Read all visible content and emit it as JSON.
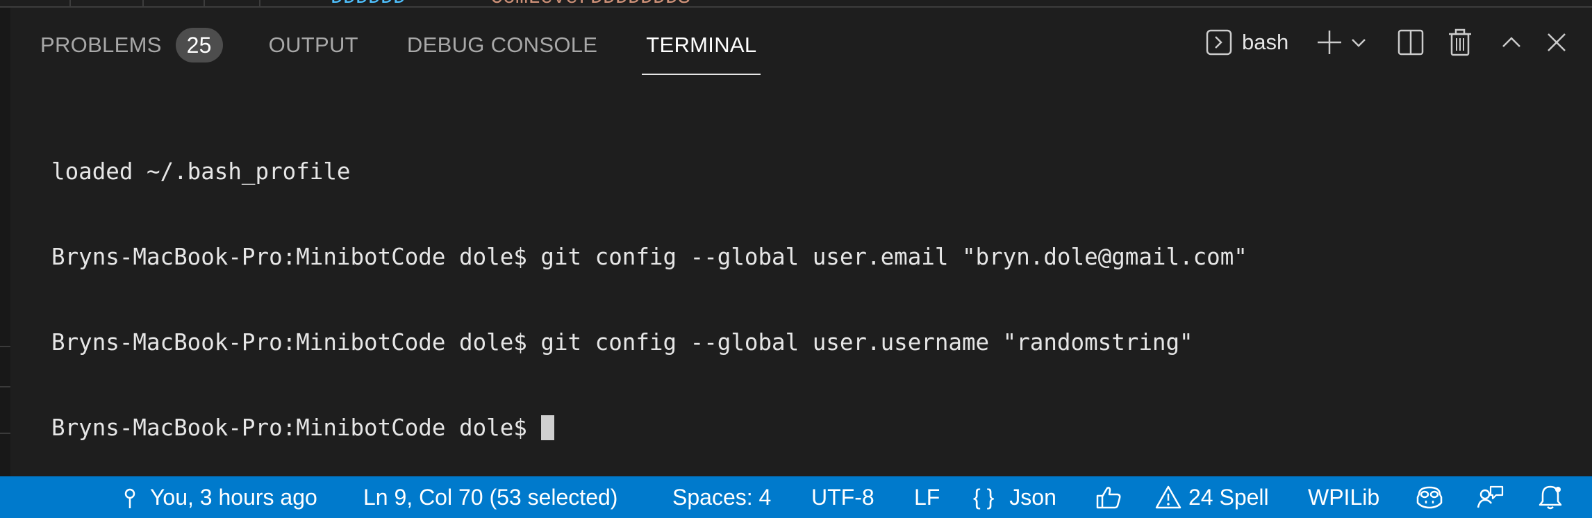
{
  "editor_fragments": {
    "left": "DDDDDD",
    "right": "ComLeverDDDDDDDS"
  },
  "panel": {
    "tabs": [
      {
        "label": "PROBLEMS",
        "badge": "25"
      },
      {
        "label": "OUTPUT"
      },
      {
        "label": "DEBUG CONSOLE"
      },
      {
        "label": "TERMINAL",
        "active": true
      }
    ]
  },
  "toolbar": {
    "terminal_name": "bash",
    "icons": [
      "terminal-icon",
      "plus-icon",
      "chevron-down-icon",
      "split-icon",
      "trash-icon",
      "chevron-up-icon",
      "close-icon"
    ]
  },
  "terminal": {
    "lines": [
      "loaded ~/.bash_profile",
      "Bryns-MacBook-Pro:MinibotCode dole$ git config --global user.email \"bryn.dole@gmail.com\"",
      "Bryns-MacBook-Pro:MinibotCode dole$ git config --global user.username \"randomstring\"",
      "Bryns-MacBook-Pro:MinibotCode dole$"
    ]
  },
  "statusbar": {
    "blame": "You, 3 hours ago",
    "position": "Ln 9, Col 70 (53 selected)",
    "spaces": "Spaces: 4",
    "encoding": "UTF-8",
    "eol": "LF",
    "language_braces": "{ }",
    "language": "Json",
    "spell": "24 Spell",
    "wpilib": "WPILib"
  },
  "colors": {
    "panel_bg": "#1e1e1e",
    "statusbar_bg": "#007acc",
    "tab_inactive": "#a8a8a8",
    "tab_active": "#ffffff",
    "badge_bg": "#4d4d4d"
  }
}
